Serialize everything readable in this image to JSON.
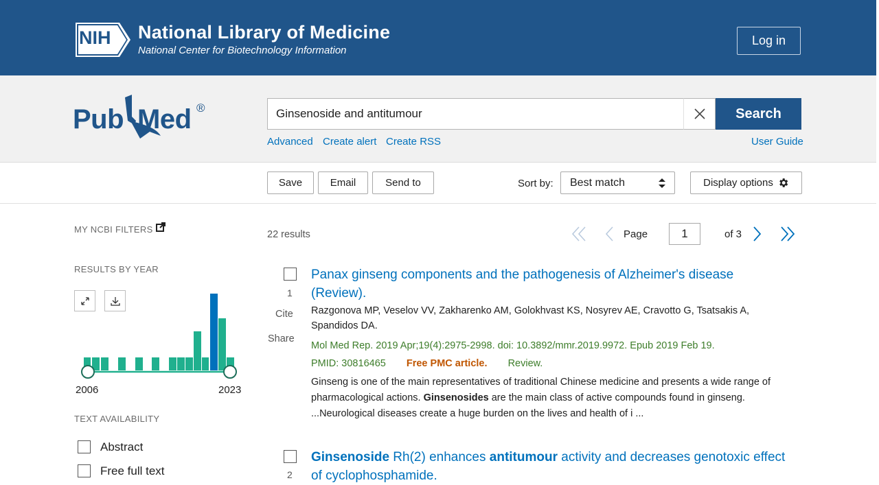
{
  "nih_header": {
    "logo_text": "NIH",
    "title": "National Library of Medicine",
    "subtitle": "National Center for Biotechnology Information",
    "login_label": "Log in",
    "bg_color": "#20558a"
  },
  "search": {
    "logo_text": "PubMed",
    "query": "Ginsenoside and antitumour",
    "clear_icon": "close-icon",
    "button_label": "Search",
    "links": {
      "advanced": "Advanced",
      "create_alert": "Create alert",
      "create_rss": "Create RSS",
      "user_guide": "User Guide"
    }
  },
  "toolbar": {
    "save": "Save",
    "email": "Email",
    "send_to": "Send to",
    "sort_label": "Sort by:",
    "sort_value": "Best match",
    "display_options": "Display options"
  },
  "sidebar": {
    "my_filters": "MY NCBI FILTERS",
    "results_by_year": "RESULTS BY YEAR",
    "year_start": "2006",
    "year_end": "2023",
    "text_availability": "TEXT AVAILABILITY",
    "filters": [
      {
        "label": "Abstract",
        "checked": false
      },
      {
        "label": "Free full text",
        "checked": false
      }
    ],
    "histogram_color": "#20b08e",
    "histogram_highlight_color": "#0071bc"
  },
  "results_meta": {
    "count": "22 results",
    "page_label": "Page",
    "page_number": "1",
    "of_pages": "of 3"
  },
  "results": [
    {
      "rank": "1",
      "title": "Panax ginseng components and the pathogenesis of Alzheimer's disease (Review).",
      "authors": "Razgonova MP, Veselov VV, Zakharenko AM, Golokhvast KS, Nosyrev AE, Cravotto G, Tsatsakis A, Spandidos DA.",
      "journal": "Mol Med Rep. 2019 Apr;19(4):2975-2998. doi: 10.3892/mmr.2019.9972. Epub 2019 Feb 19.",
      "pmid": "PMID: 30816465",
      "free_pmc": "Free PMC article.",
      "pub_type": "Review.",
      "snippet_1": "Ginseng is one of the main representatives of traditional Chinese medicine and presents a wide range of pharmacological actions. ",
      "snippet_bold": "Ginsenosides",
      "snippet_2": " are the main class of active compounds found in ginseng. ...Neurological diseases create a huge burden on the lives and health of i ...",
      "cite": "Cite",
      "share": "Share"
    },
    {
      "rank": "2",
      "title_bold_1": "Ginsenoside",
      "title_part_1": " Rh(2) enhances ",
      "title_bold_2": "antitumour",
      "title_part_2": " activity and decreases genotoxic effect of cyclophosphamide."
    }
  ]
}
